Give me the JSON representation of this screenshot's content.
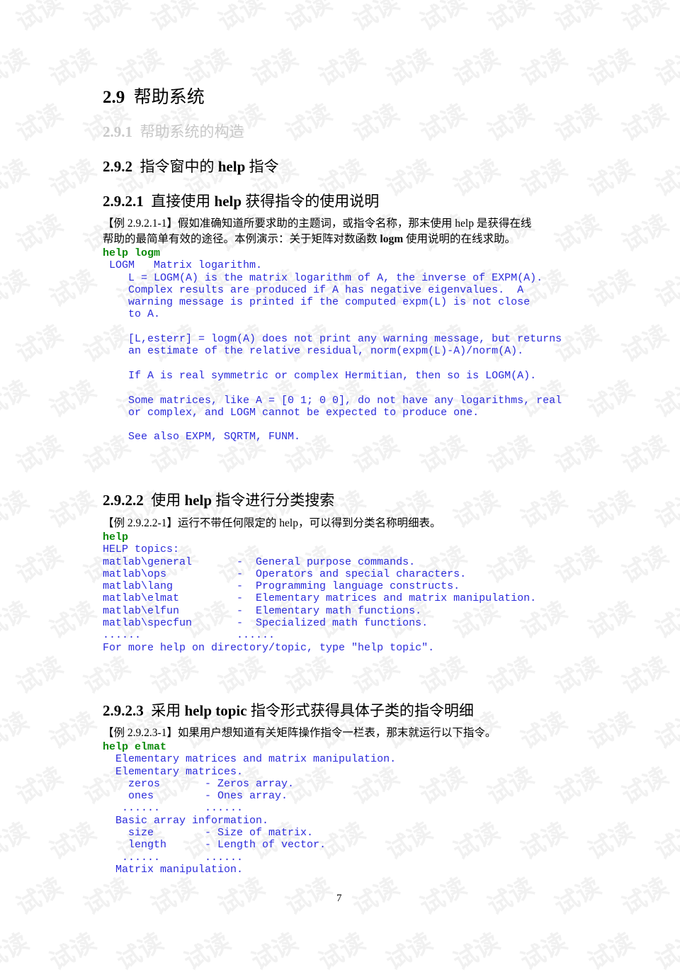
{
  "watermark_text": "试读",
  "sections": {
    "s29": {
      "num": "2.9",
      "title": "帮助系统"
    },
    "s291": {
      "num": "2.9.1",
      "title": "帮助系统的构造"
    },
    "s292": {
      "num": "2.9.2",
      "title_a": "指令窗中的",
      "title_b": "help",
      "title_c": "指令"
    },
    "s2921": {
      "num": "2.9.2.1",
      "title_a": "直接使用",
      "title_b": "help",
      "title_c": "获得指令的使用说明"
    },
    "s2922": {
      "num": "2.9.2.2",
      "title_a": "使用",
      "title_b": "help",
      "title_c": "指令进行分类搜索"
    },
    "s2923": {
      "num": "2.9.2.3",
      "title_a": "采用",
      "title_b": "help topic",
      "title_c": "指令形式获得具体子类的指令明细"
    }
  },
  "example1": {
    "label": "【例 2.9.2.1-1】",
    "text_a": "假如准确知道所要求助的主题词，或指令名称，那末使用 help 是获得在线",
    "text_b": "帮助的最简单有效的途径。本例演示：关于矩阵对数函数 ",
    "text_bold": "logm",
    "text_c": " 使用说明的在线求助。",
    "command": "help logm",
    "output": [
      " LOGM   Matrix logarithm.",
      "    L = LOGM(A) is the matrix logarithm of A, the inverse of EXPM(A).",
      "    Complex results are produced if A has negative eigenvalues.  A",
      "    warning message is printed if the computed expm(L) is not close",
      "    to A.",
      "",
      "    [L,esterr] = logm(A) does not print any warning message, but returns",
      "    an estimate of the relative residual, norm(expm(L)-A)/norm(A).",
      "",
      "    If A is real symmetric or complex Hermitian, then so is LOGM(A).",
      "",
      "    Some matrices, like A = [0 1; 0 0], do not have any logarithms, real",
      "    or complex, and LOGM cannot be expected to produce one.",
      "",
      "    See also EXPM, SQRTM, FUNM."
    ]
  },
  "example2": {
    "label": "【例 2.9.2.2-1】",
    "text": "运行不带任何限定的 help，可以得到分类名称明细表。",
    "command": "help",
    "output": [
      "HELP topics:",
      "matlab\\general       -  General purpose commands.",
      "matlab\\ops           -  Operators and special characters.",
      "matlab\\lang          -  Programming language constructs.",
      "matlab\\elmat         -  Elementary matrices and matrix manipulation.",
      "matlab\\elfun         -  Elementary math functions.",
      "matlab\\specfun       -  Specialized math functions.",
      "......               ......",
      "For more help on directory/topic, type \"help topic\"."
    ]
  },
  "example3": {
    "label": "【例 2.9.2.3-1】",
    "text": "如果用户想知道有关矩阵操作指令一栏表，那末就运行以下指令。",
    "command": "help elmat",
    "output": [
      "  Elementary matrices and matrix manipulation.",
      "  Elementary matrices.",
      "    zeros       - Zeros array.",
      "    ones        - Ones array.",
      "   ......       ......",
      "  Basic array information.",
      "    size        - Size of matrix.",
      "    length      - Length of vector.",
      "   ......       ......",
      "  Matrix manipulation."
    ]
  },
  "page_number": "7"
}
